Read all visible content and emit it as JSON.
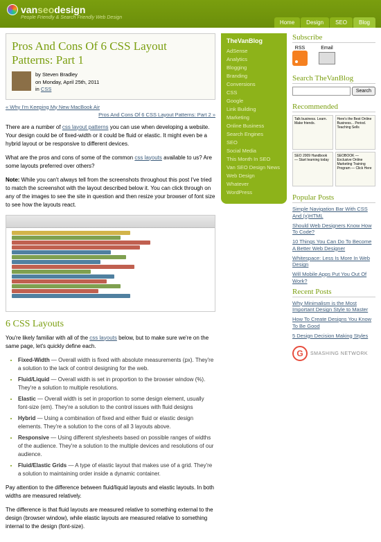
{
  "header": {
    "brand_pre": "van",
    "brand_mid": "seo",
    "brand_post": "design",
    "tagline": "People Friendly & Search Friendly Web Design",
    "nav": [
      "Home",
      "Design",
      "SEO",
      "Blog"
    ],
    "nav_active": 3
  },
  "article": {
    "title": "Pros And Cons Of 6 CSS Layout Patterns: Part 1",
    "author": "by Steven Bradley",
    "date": "on Monday, April 25th, 2011",
    "in_prefix": "in ",
    "category": "CSS",
    "prev": "« Why I'm Keeping My New MacBook Air",
    "next": "Pros And Cons Of 6 CSS Layout Patterns: Part 2 »",
    "p1a": "There are a number of ",
    "p1_link": "css layout patterns",
    "p1b": " you can use when developing a website. Your design could be of fixed-width or it could be fluid or elastic. It might even be a hybrid layout or be responsive to different devices.",
    "p2a": "What are the pros and cons of some of the common ",
    "p2_link": "css layouts",
    "p2b": " available to us? Are some layouts preferred over others?",
    "note_label": "Note:",
    "note": " While you can't always tell from the screenshots throughout this post I've tried to match the screenshot with the layout described below it. You can click through on any of the images to see the site in question and then resize your browser of font size to see how the layouts react.",
    "h2": "6 CSS Layouts",
    "p3a": "You're likely familiar with all of the ",
    "p3_link": "css layouts",
    "p3b": " below, but to make sure we're on the same page, let's quickly define each.",
    "layouts": [
      {
        "name": "Fixed-Width",
        "desc": " — Overall width is fixed with absolute measurements (px). They're a solution to the lack of control designing for the web."
      },
      {
        "name": "Fluid/Liquid",
        "desc": " — Overall width is set in proportion to the browser window (%). They're a solution to multiple resolutions."
      },
      {
        "name": "Elastic",
        "desc": " — Overall width is set in proportion to some design element, usually font-size (em). They're a solution to the control issues with fluid designs"
      },
      {
        "name": "Hybrid",
        "desc": " — Using a combination of fixed and either fluid or elastic design elements. They're a solution to the cons of all 3 layouts above."
      },
      {
        "name": "Responsive",
        "desc": " — Using different stylesheets based on possible ranges of widths of the audience. They're a solution to the multiple devices and resolutions of our audience."
      },
      {
        "name": "Fluid/Elastic Grids",
        "desc": " — A type of elastic layout that makes use of a grid. They're a solution to maintaining order inside a dynamic container."
      }
    ],
    "p4": "Pay attention to the difference between fluid/liquid layouts and elastic layouts. In both widths are measured relatively.",
    "p5": "The difference is that fluid layouts are measured relative to something external to the design (browser window), while elastic layouts are measured relative to something internal to the design (font-size)."
  },
  "menu": {
    "title": "TheVanBlog",
    "items": [
      "AdSense",
      "Analytics",
      "Blogging",
      "Branding",
      "Conversions",
      "CSS",
      "Google",
      "Link Building",
      "Marketing",
      "Online Business",
      "Search Engines",
      "SEO",
      "Social Media",
      "This Month In SEO",
      "Van SEO Design News",
      "Web Design",
      "Whatever",
      "WordPress"
    ]
  },
  "right": {
    "subscribe_h": "Subscribe",
    "rss": "RSS",
    "email": "Email",
    "search_h": "Search TheVanBlog",
    "search_btn": "Search",
    "rec_h": "Recommended",
    "ads": [
      "Talk business. Learn. Make friends.",
      "Here's the Best Online Business... Period. Teaching Sells",
      "SEO 2009 Handbook — Start learning today",
      "SEOBOOK — Exclusive Online Marketing Training Program — Click Here"
    ],
    "pop_h": "Popular Posts",
    "pop": [
      "Simple Navigation Bar With CSS And (x)HTML",
      "Should Web Designers Know How To Code?",
      "10 Things You Can Do To Become A Better Web Designer",
      "Whitespace: Less Is More In Web Design",
      "Will Mobile Apps Put You Out Of Work?"
    ],
    "rec_posts_h": "Recent Posts",
    "recent": [
      "Why Minimalism is the Most Important Design Style to Master",
      "How To Create Designs You Know To Be Good",
      "5 Design Decision Making Styles"
    ],
    "smashing": "SMASHING NETWORK"
  }
}
